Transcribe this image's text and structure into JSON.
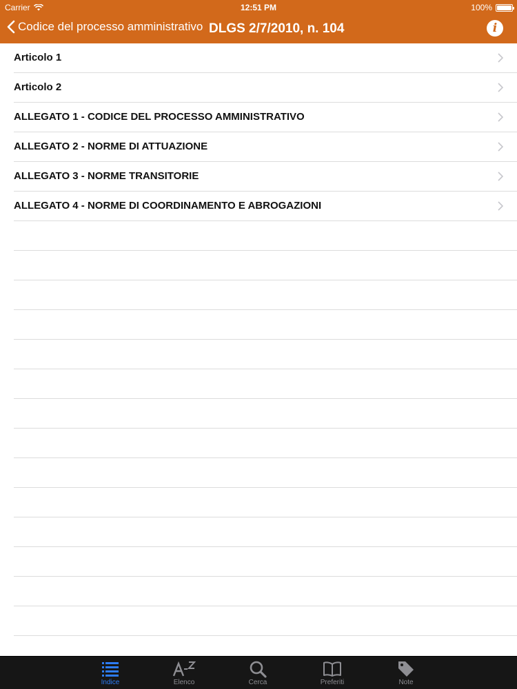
{
  "status": {
    "carrier": "Carrier",
    "time": "12:51 PM",
    "battery": "100%"
  },
  "nav": {
    "back_label": "Codice del processo amministrativo",
    "title": "DLGS 2/7/2010, n. 104"
  },
  "items": [
    {
      "label": "Articolo 1"
    },
    {
      "label": "Articolo 2"
    },
    {
      "label": "ALLEGATO 1 - CODICE DEL PROCESSO AMMINISTRATIVO"
    },
    {
      "label": "ALLEGATO 2 - NORME DI ATTUAZIONE"
    },
    {
      "label": "ALLEGATO 3 - NORME TRANSITORIE"
    },
    {
      "label": "ALLEGATO 4 - NORME DI COORDINAMENTO E ABROGAZIONI"
    }
  ],
  "tabs": [
    {
      "label": "Indice",
      "icon": "list-icon",
      "active": true
    },
    {
      "label": "Elenco",
      "icon": "a-z-icon",
      "active": false
    },
    {
      "label": "Cerca",
      "icon": "search-icon",
      "active": false
    },
    {
      "label": "Preferiti",
      "icon": "book-icon",
      "active": false
    },
    {
      "label": "Note",
      "icon": "tag-icon",
      "active": false
    }
  ],
  "colors": {
    "nav_background": "#d2691b",
    "tab_background": "#161616",
    "tab_active": "#2d7cf6",
    "tab_inactive": "#8e8e93"
  }
}
